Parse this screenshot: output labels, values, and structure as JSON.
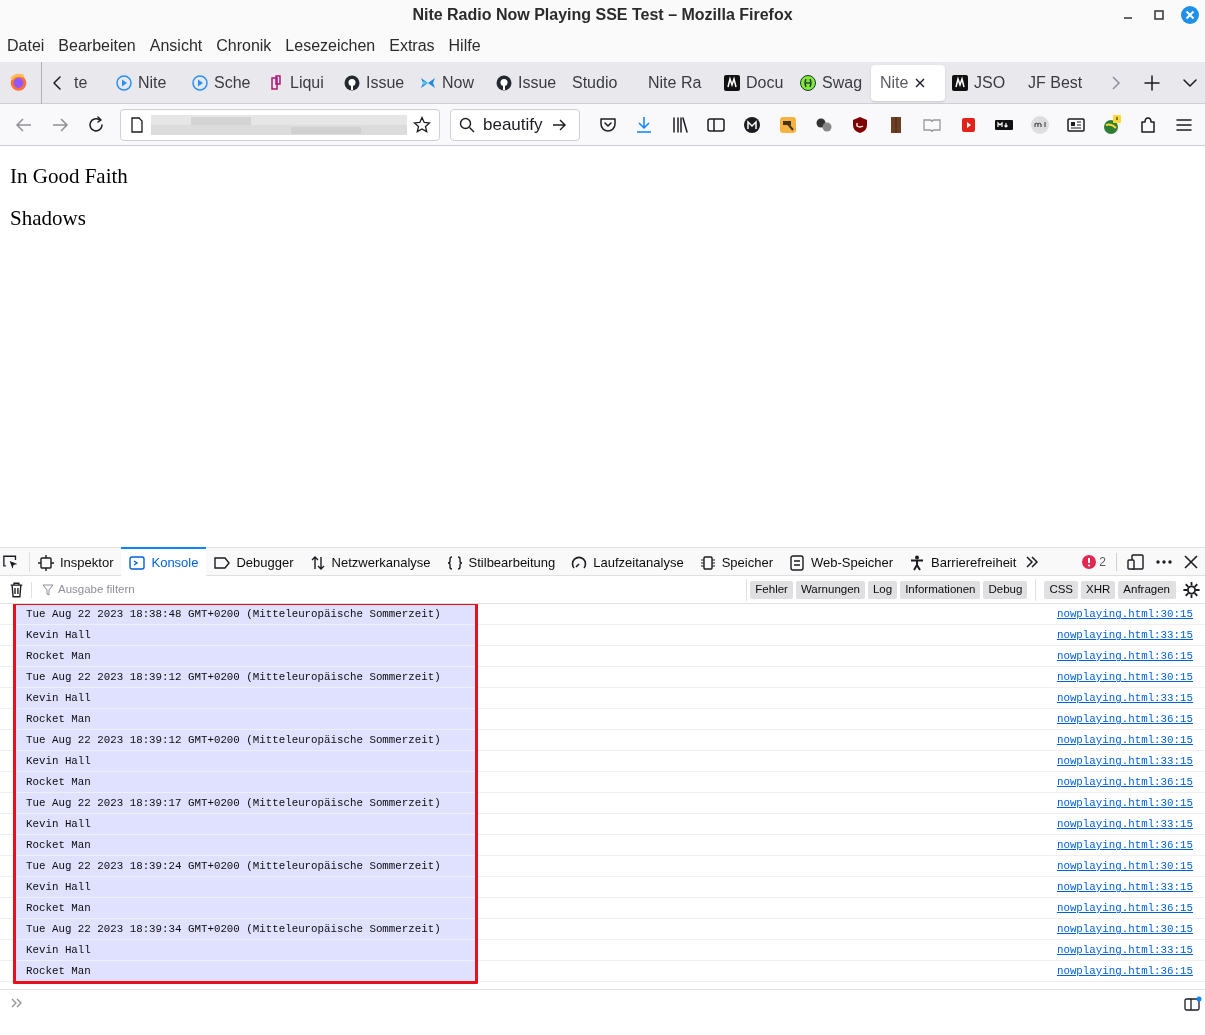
{
  "window": {
    "title": "Nite Radio Now Playing SSE Test – Mozilla Firefox"
  },
  "menu": [
    "Datei",
    "Bearbeiten",
    "Ansicht",
    "Chronik",
    "Lesezeichen",
    "Extras",
    "Hilfe"
  ],
  "tabs": [
    {
      "label": "te",
      "kind": "none",
      "selected": false
    },
    {
      "label": "Nite",
      "kind": "play",
      "selected": false
    },
    {
      "label": "Sche",
      "kind": "play",
      "selected": false
    },
    {
      "label": "Liqui",
      "kind": "clip",
      "selected": false
    },
    {
      "label": "Issue",
      "kind": "github",
      "selected": false
    },
    {
      "label": "Now",
      "kind": "butterfly",
      "selected": false
    },
    {
      "label": "Issue",
      "kind": "github",
      "selected": false
    },
    {
      "label": "Studio",
      "kind": "none",
      "selected": false
    },
    {
      "label": "Nite Ra",
      "kind": "none",
      "selected": false
    },
    {
      "label": "Docu",
      "kind": "mlogo",
      "selected": false
    },
    {
      "label": "Swag",
      "kind": "swagger",
      "selected": false
    },
    {
      "label": "Nite",
      "kind": "none",
      "selected": true
    },
    {
      "label": "JSO",
      "kind": "mlogo",
      "selected": false
    },
    {
      "label": "JF Best",
      "kind": "none",
      "selected": false
    }
  ],
  "search": {
    "value": "beautify"
  },
  "page": {
    "lines": [
      "In Good Faith",
      "Shadows"
    ]
  },
  "devtools": {
    "tabs": [
      {
        "label": "Inspektor",
        "kind": "inspector",
        "selected": false
      },
      {
        "label": "Konsole",
        "kind": "console",
        "selected": true
      },
      {
        "label": "Debugger",
        "kind": "debugger",
        "selected": false
      },
      {
        "label": "Netzwerkanalyse",
        "kind": "network",
        "selected": false
      },
      {
        "label": "Stilbearbeitung",
        "kind": "style",
        "selected": false
      },
      {
        "label": "Laufzeitanalyse",
        "kind": "performance",
        "selected": false
      },
      {
        "label": "Speicher",
        "kind": "memory",
        "selected": false
      },
      {
        "label": "Web-Speicher",
        "kind": "storage",
        "selected": false
      },
      {
        "label": "Barrierefreiheit",
        "kind": "accessibility",
        "selected": false
      }
    ],
    "error_count": "2",
    "filter": {
      "placeholder": "Ausgabe filtern"
    },
    "levels": [
      "Fehler",
      "Warnungen",
      "Log",
      "Informationen",
      "Debug"
    ],
    "types": [
      "CSS",
      "XHR",
      "Anfragen"
    ],
    "rows": [
      {
        "message": "Tue Aug 22 2023 18:38:48 GMT+0200 (Mitteleuropäische Sommerzeit)",
        "source": "nowplaying.html:30:15",
        "highlighted": true
      },
      {
        "message": "Kevin Hall",
        "source": "nowplaying.html:33:15",
        "highlighted": true
      },
      {
        "message": "Rocket Man",
        "source": "nowplaying.html:36:15",
        "highlighted": true
      },
      {
        "message": "Tue Aug 22 2023 18:39:12 GMT+0200 (Mitteleuropäische Sommerzeit)",
        "source": "nowplaying.html:30:15",
        "highlighted": true
      },
      {
        "message": "Kevin Hall",
        "source": "nowplaying.html:33:15",
        "highlighted": true
      },
      {
        "message": "Rocket Man",
        "source": "nowplaying.html:36:15",
        "highlighted": true
      },
      {
        "message": "Tue Aug 22 2023 18:39:12 GMT+0200 (Mitteleuropäische Sommerzeit)",
        "source": "nowplaying.html:30:15",
        "highlighted": true
      },
      {
        "message": "Kevin Hall",
        "source": "nowplaying.html:33:15",
        "highlighted": true
      },
      {
        "message": "Rocket Man",
        "source": "nowplaying.html:36:15",
        "highlighted": true
      },
      {
        "message": "Tue Aug 22 2023 18:39:17 GMT+0200 (Mitteleuropäische Sommerzeit)",
        "source": "nowplaying.html:30:15",
        "highlighted": true
      },
      {
        "message": "Kevin Hall",
        "source": "nowplaying.html:33:15",
        "highlighted": true
      },
      {
        "message": "Rocket Man",
        "source": "nowplaying.html:36:15",
        "highlighted": true
      },
      {
        "message": "Tue Aug 22 2023 18:39:24 GMT+0200 (Mitteleuropäische Sommerzeit)",
        "source": "nowplaying.html:30:15",
        "highlighted": true
      },
      {
        "message": "Kevin Hall",
        "source": "nowplaying.html:33:15",
        "highlighted": true
      },
      {
        "message": "Rocket Man",
        "source": "nowplaying.html:36:15",
        "highlighted": true
      },
      {
        "message": "Tue Aug 22 2023 18:39:34 GMT+0200 (Mitteleuropäische Sommerzeit)",
        "source": "nowplaying.html:30:15",
        "highlighted": true
      },
      {
        "message": "Kevin Hall",
        "source": "nowplaying.html:33:15",
        "highlighted": true
      },
      {
        "message": "Rocket Man",
        "source": "nowplaying.html:36:15",
        "highlighted": true
      }
    ]
  }
}
